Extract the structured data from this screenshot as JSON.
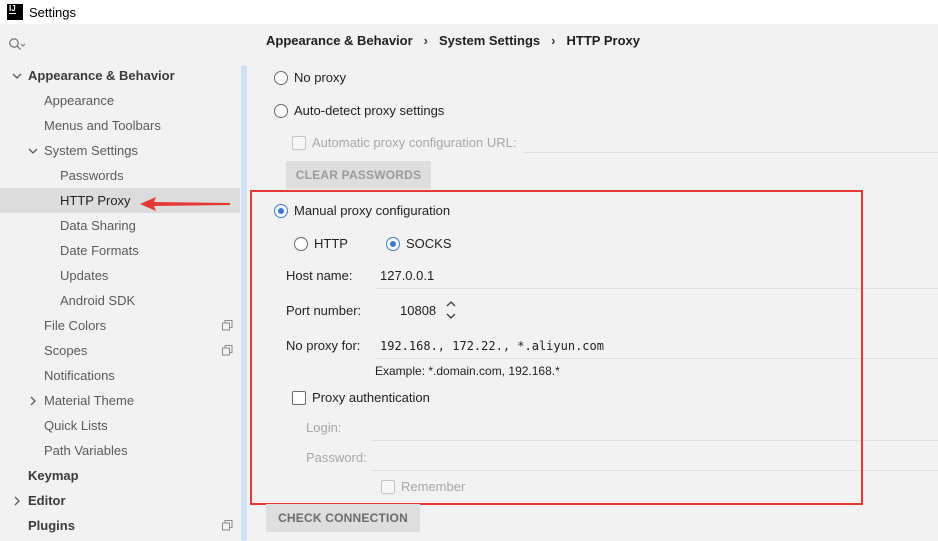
{
  "window": {
    "title": "Settings",
    "logo_text": "IJ"
  },
  "sidebar": {
    "items": [
      {
        "label": "Appearance & Behavior"
      },
      {
        "label": "Appearance"
      },
      {
        "label": "Menus and Toolbars"
      },
      {
        "label": "System Settings"
      },
      {
        "label": "Passwords"
      },
      {
        "label": "HTTP Proxy"
      },
      {
        "label": "Data Sharing"
      },
      {
        "label": "Date Formats"
      },
      {
        "label": "Updates"
      },
      {
        "label": "Android SDK"
      },
      {
        "label": "File Colors"
      },
      {
        "label": "Scopes"
      },
      {
        "label": "Notifications"
      },
      {
        "label": "Material Theme"
      },
      {
        "label": "Quick Lists"
      },
      {
        "label": "Path Variables"
      },
      {
        "label": "Keymap"
      },
      {
        "label": "Editor"
      },
      {
        "label": "Plugins"
      }
    ]
  },
  "breadcrumb": [
    "Appearance & Behavior",
    "System Settings",
    "HTTP Proxy"
  ],
  "proxy": {
    "no_proxy": "No proxy",
    "auto_detect": "Auto-detect proxy settings",
    "auto_config_url": "Automatic proxy configuration URL:",
    "clear_passwords": "CLEAR PASSWORDS",
    "manual": "Manual proxy configuration",
    "http": "HTTP",
    "socks": "SOCKS",
    "host_label": "Host name:",
    "host_value": "127.0.0.1",
    "port_label": "Port number:",
    "port_value": "10808",
    "no_proxy_for_label": "No proxy for:",
    "no_proxy_for_value": "192.168., 172.22., *.aliyun.com",
    "example": "Example: *.domain.com, 192.168.*",
    "auth_label": "Proxy authentication",
    "login_label": "Login:",
    "password_label": "Password:",
    "remember_label": "Remember",
    "check_connection": "CHECK CONNECTION"
  }
}
